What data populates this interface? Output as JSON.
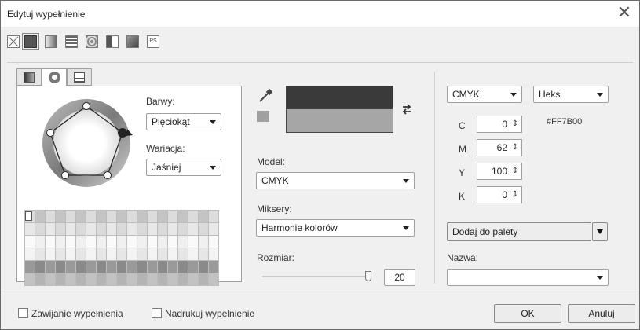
{
  "window": {
    "title": "Edytuj wypełnienie",
    "close_glyph": "✕"
  },
  "toolbar": {
    "icons": [
      "no-fill-icon",
      "uniform-fill-icon",
      "fountain-fill-icon",
      "pattern-fill-icon",
      "texture-fill-icon",
      "vector-fill-icon",
      "bitmap-fill-icon",
      "postscript-fill-icon"
    ]
  },
  "left_panel": {
    "tabs": [
      "models-tab",
      "harmonies-tab",
      "palettes-tab"
    ],
    "barwy_label": "Barwy:",
    "barwy_value": "Pięciokąt",
    "wariacja_label": "Wariacja:",
    "wariacja_value": "Jaśniej"
  },
  "middle_panel": {
    "model_label": "Model:",
    "model_value": "CMYK",
    "miksery_label": "Miksery:",
    "miksery_value": "Harmonie kolorów",
    "rozmiar_label": "Rozmiar:",
    "rozmiar_value": "20",
    "color_old": "#3a3a3a",
    "color_new": "#a6a6a6",
    "swatch": "#a0a0a0"
  },
  "right_panel": {
    "model_select": "CMYK",
    "format_select": "Heks",
    "hex_value": "#FF7B00",
    "channels": [
      {
        "label": "C",
        "value": "0"
      },
      {
        "label": "M",
        "value": "62"
      },
      {
        "label": "Y",
        "value": "100"
      },
      {
        "label": "K",
        "value": "0"
      }
    ],
    "add_to_palette": "Dodaj do palety",
    "name_label": "Nazwa:",
    "name_value": ""
  },
  "footer": {
    "wrap_fill": "Zawijanie wypełnienia",
    "overprint_fill": "Nadrukuj wypełnienie",
    "ok": "OK",
    "cancel": "Anuluj"
  }
}
